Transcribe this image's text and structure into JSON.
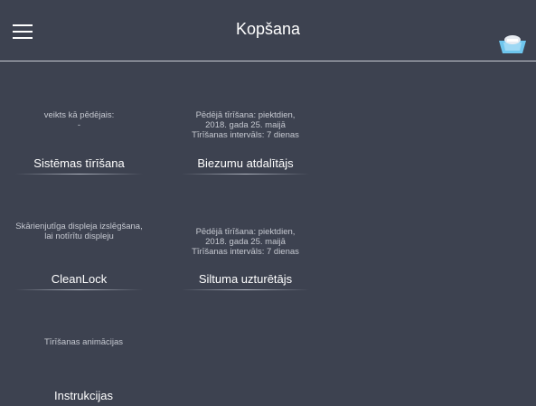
{
  "header": {
    "title": "Kopšana",
    "menu_icon": "hamburger-menu-icon",
    "machine_icon": "coffee-machine-icon"
  },
  "colors": {
    "background": "#3d4250",
    "divider": "#c8ccd4",
    "text": "#ffffff",
    "muted_text": "#c6c9d1",
    "icon_accent": "#6ec6ee"
  },
  "tiles": [
    {
      "info_lines": [
        "veikts kā pēdējais:",
        "-"
      ],
      "label": "Sistēmas tīrīšana"
    },
    {
      "info_lines": [
        "Pēdējā tīrīšana: piektdien,",
        "2018. gada 25. maijā",
        "Tīrīšanas intervāls: 7 dienas"
      ],
      "label": "Biezumu atdalītājs"
    },
    {
      "info_lines": [
        "Skārienjutīga displeja izslēgšana,",
        "lai notīrītu displeju"
      ],
      "label": "CleanLock"
    },
    {
      "info_lines": [
        "Pēdējā tīrīšana: piektdien,",
        "2018. gada 25. maijā",
        "Tīrīšanas intervāls: 7 dienas"
      ],
      "label": "Siltuma uzturētājs"
    },
    {
      "info_lines": [
        "Tīrīšanas animācijas"
      ],
      "label": "Instrukcijas"
    }
  ]
}
